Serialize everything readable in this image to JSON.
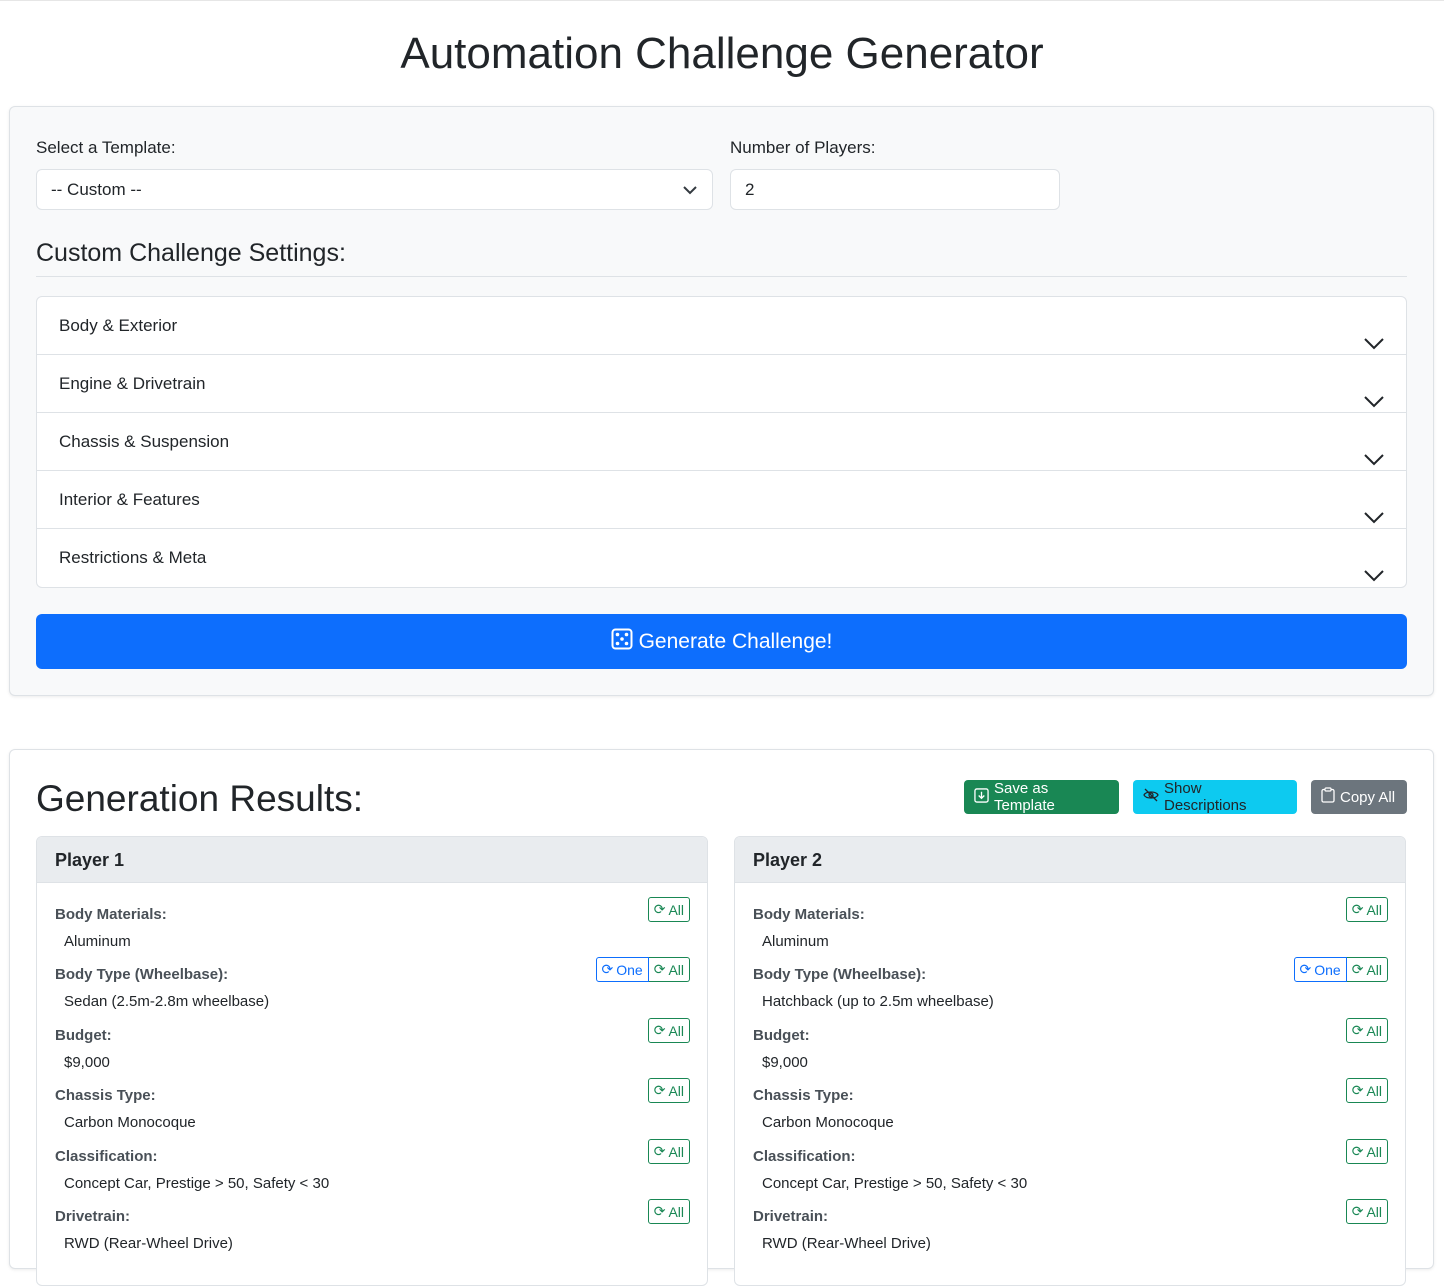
{
  "page": {
    "title": "Automation Challenge Generator"
  },
  "settings": {
    "template_label": "Select a Template:",
    "template_value": "-- Custom --",
    "players_label": "Number of Players:",
    "players_value": "2",
    "heading": "Custom Challenge Settings:",
    "sections": [
      "Body & Exterior",
      "Engine & Drivetrain",
      "Chassis & Suspension",
      "Interior & Features",
      "Restrictions & Meta"
    ],
    "generate_label": "Generate Challenge!"
  },
  "results": {
    "title": "Generation Results:",
    "save_label": "Save as Template",
    "desc_label": "Show Descriptions",
    "copy_label": "Copy All",
    "one_label": "One",
    "all_label": "All",
    "players": [
      {
        "name": "Player 1",
        "rows": [
          {
            "label": "Body Materials:",
            "value": "Aluminum"
          },
          {
            "label": "Body Type (Wheelbase):",
            "value": "Sedan (2.5m-2.8m wheelbase)"
          },
          {
            "label": "Budget:",
            "value": "$9,000"
          },
          {
            "label": "Chassis Type:",
            "value": "Carbon Monocoque"
          },
          {
            "label": "Classification:",
            "value": "Concept Car, Prestige > 50, Safety < 30"
          },
          {
            "label": "Drivetrain:",
            "value": "RWD (Rear-Wheel Drive)"
          }
        ]
      },
      {
        "name": "Player 2",
        "rows": [
          {
            "label": "Body Materials:",
            "value": "Aluminum"
          },
          {
            "label": "Body Type (Wheelbase):",
            "value": "Hatchback (up to 2.5m wheelbase)"
          },
          {
            "label": "Budget:",
            "value": "$9,000"
          },
          {
            "label": "Chassis Type:",
            "value": "Carbon Monocoque"
          },
          {
            "label": "Classification:",
            "value": "Concept Car, Prestige > 50, Safety < 30"
          },
          {
            "label": "Drivetrain:",
            "value": "RWD (Rear-Wheel Drive)"
          }
        ]
      }
    ]
  },
  "colors": {
    "primary": "#0d6efd",
    "success": "#198754",
    "info": "#0dcaf0",
    "secondary": "#6c757d"
  }
}
